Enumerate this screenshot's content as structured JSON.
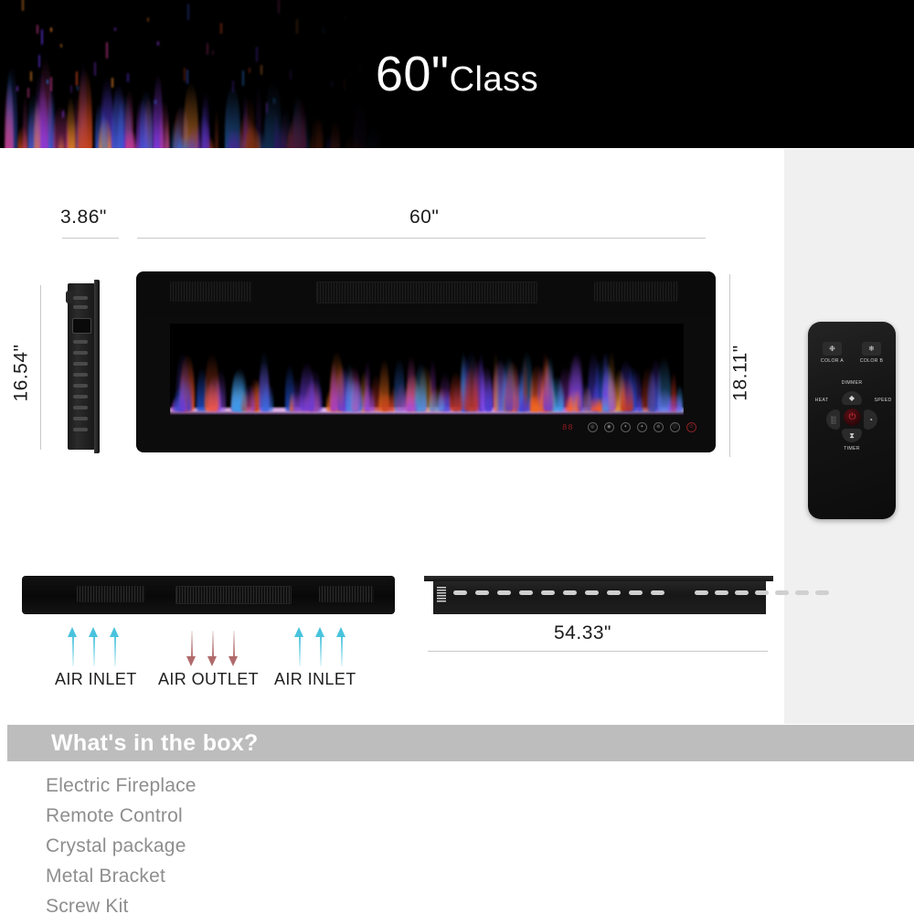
{
  "banner": {
    "title_main": "60\"",
    "title_sub": "Class"
  },
  "dimensions": {
    "depth": "3.86\"",
    "width": "60\"",
    "side_height": "16.54\"",
    "front_height": "18.11\"",
    "bracket_width": "54.33\""
  },
  "fireplace": {
    "display_value": "88",
    "control_icons": [
      "flame-icon",
      "dimmer-icon",
      "speed-icon",
      "color-icon",
      "heat-icon",
      "timer-icon",
      "power-icon"
    ],
    "control_glyphs": [
      "◎",
      "◉",
      "✶",
      "✦",
      "⊚",
      "ⓘ",
      "⏻"
    ]
  },
  "remote": {
    "color_a_label": "COLOR A",
    "color_b_label": "COLOR B",
    "dimmer_label": "DIMMER",
    "heat_label": "HEAT",
    "speed_label": "SPEED",
    "timer_label": "TIMER",
    "color_a_glyph": "❉",
    "color_b_glyph": "❄",
    "dimmer_glyph": "◆",
    "timer_glyph": "⧗",
    "left_glyph": "▒",
    "right_glyph": "◔",
    "power_glyph": "⏻"
  },
  "airflow": {
    "inlet_left_label": "AIR INLET",
    "outlet_label": "AIR OUTLET",
    "inlet_right_label": "AIR INLET",
    "inlet_color": "#49c3dd",
    "outlet_color": "#b06a6a"
  },
  "whats_in_box": {
    "heading": "What's in the box?",
    "items": [
      "Electric Fireplace",
      "Remote Control",
      "Crystal package",
      "Metal Bracket",
      "Screw Kit"
    ]
  },
  "colors": {
    "banner_background": "#000000",
    "gray_panel": "#f0f0f0",
    "box_bar": "#bdbdbd",
    "list_text": "#8e8e8e",
    "dimension_line": "#c9c9c9"
  }
}
